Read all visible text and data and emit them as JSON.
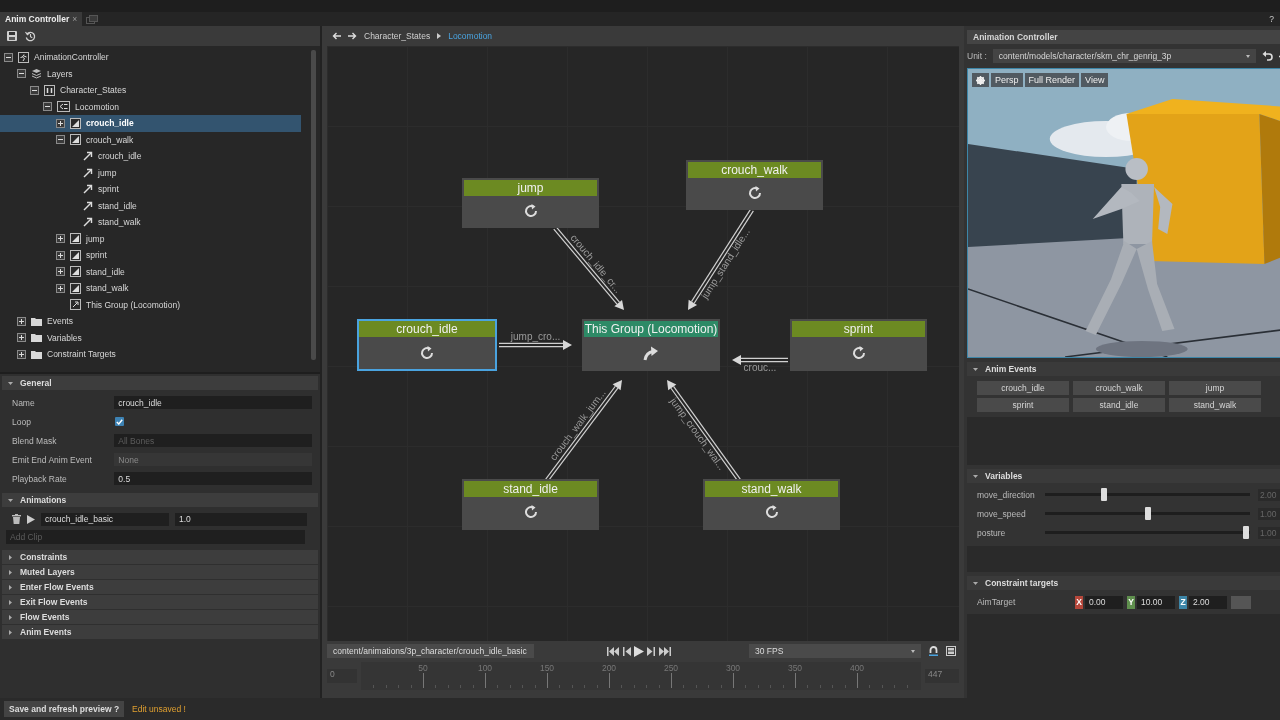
{
  "tabs": [
    {
      "label": "Anim Controller",
      "close": "×",
      "selected": true
    }
  ],
  "help": "?",
  "tree": [
    {
      "label": "AnimationController",
      "kind": "root",
      "expanded": true,
      "selected": false,
      "children": [
        {
          "label": "Layers",
          "kind": "layers",
          "expanded": true,
          "selected": false,
          "children": [
            {
              "label": "Character_States",
              "kind": "layer",
              "expanded": true,
              "selected": false,
              "children": [
                {
                  "label": "Locomotion",
                  "kind": "group",
                  "expanded": true,
                  "selected": false,
                  "children": [
                    {
                      "label": "crouch_idle",
                      "kind": "state",
                      "expanded": false,
                      "selected": true
                    },
                    {
                      "label": "crouch_walk",
                      "kind": "state",
                      "expanded": true,
                      "selected": false,
                      "children": [
                        {
                          "label": "crouch_idle",
                          "kind": "transition",
                          "selected": false
                        },
                        {
                          "label": "jump",
                          "kind": "transition",
                          "selected": false
                        },
                        {
                          "label": "sprint",
                          "kind": "transition",
                          "selected": false
                        },
                        {
                          "label": "stand_idle",
                          "kind": "transition",
                          "selected": false
                        },
                        {
                          "label": "stand_walk",
                          "kind": "transition",
                          "selected": false
                        }
                      ]
                    },
                    {
                      "label": "jump",
                      "kind": "state",
                      "expanded": false,
                      "selected": false
                    },
                    {
                      "label": "sprint",
                      "kind": "state",
                      "expanded": false,
                      "selected": false
                    },
                    {
                      "label": "stand_idle",
                      "kind": "state",
                      "expanded": false,
                      "selected": false
                    },
                    {
                      "label": "stand_walk",
                      "kind": "state",
                      "expanded": false,
                      "selected": false
                    },
                    {
                      "label": "This Group (Locomotion)",
                      "kind": "exit",
                      "selected": false
                    }
                  ]
                }
              ]
            }
          ]
        },
        {
          "label": "Events",
          "kind": "folder",
          "expanded": false,
          "selected": false
        },
        {
          "label": "Variables",
          "kind": "folder",
          "expanded": false,
          "selected": false
        },
        {
          "label": "Constraint Targets",
          "kind": "folder",
          "expanded": false,
          "selected": false
        }
      ]
    }
  ],
  "sections": [
    {
      "title": "General",
      "kind": "fields",
      "expanded": true,
      "fields": [
        {
          "label": "Name",
          "kind": "text",
          "value": "crouch_idle",
          "disabled": false
        },
        {
          "label": "Loop",
          "kind": "checkbox",
          "checked": true
        },
        {
          "label": "Blend Mask",
          "kind": "text",
          "placeholder": "All Bones",
          "disabled": false
        },
        {
          "label": "Emit End Anim Event",
          "kind": "text",
          "placeholder": "None",
          "disabled": true
        },
        {
          "label": "Playback Rate",
          "kind": "text",
          "value": "0.5",
          "disabled": false
        }
      ]
    },
    {
      "title": "Animations",
      "kind": "clips",
      "expanded": true,
      "clips": [
        {
          "name": "crouch_idle_basic",
          "weight": "1.0"
        }
      ],
      "add_placeholder": "Add Clip"
    },
    {
      "title": "Constraints",
      "kind": "empty",
      "expanded": false
    },
    {
      "title": "Muted Layers",
      "kind": "empty",
      "expanded": false
    },
    {
      "title": "Enter Flow Events",
      "kind": "empty",
      "expanded": false
    },
    {
      "title": "Exit Flow Events",
      "kind": "empty",
      "expanded": false
    },
    {
      "title": "Flow Events",
      "kind": "empty",
      "expanded": false
    },
    {
      "title": "Anim Events",
      "kind": "empty",
      "expanded": false
    }
  ],
  "save_button": "Save and refresh preview ?",
  "status": "Edit unsaved !",
  "breadcrumb": [
    {
      "label": "Character_States",
      "selected": false
    },
    {
      "label": "Locomotion",
      "selected": true
    }
  ],
  "graph": {
    "nodes": [
      {
        "label": "jump",
        "kind": "state",
        "selected": false,
        "edge_label": "crouch_idle_cr..."
      },
      {
        "label": "crouch_walk",
        "kind": "state",
        "selected": false,
        "edge_label": "jump_stand_idle..."
      },
      {
        "label": "crouch_idle",
        "kind": "state",
        "selected": true,
        "edge_label": "jump_cro..."
      },
      {
        "label": "This Group (Locomotion)",
        "kind": "group",
        "selected": false
      },
      {
        "label": "sprint",
        "kind": "state",
        "selected": false,
        "edge_label": "crouc..."
      },
      {
        "label": "stand_idle",
        "kind": "state",
        "selected": false,
        "edge_label": "crouch_walk_jum..."
      },
      {
        "label": "stand_walk",
        "kind": "state",
        "selected": false,
        "edge_label": "jump_crouch_wal..."
      }
    ]
  },
  "timeline": {
    "clip": "content/animations/3p_character/crouch_idle_basic",
    "fps": "30 FPS",
    "start": "0",
    "end": "447",
    "ticks": [
      "50",
      "100",
      "150",
      "200",
      "250",
      "300",
      "350",
      "400"
    ]
  },
  "preview": {
    "title": "Animation Controller",
    "unit_label": "Unit :",
    "unit": "content/models/character/skm_chr_genrig_3p",
    "view_buttons": [
      "Persp",
      "Full Render",
      "View"
    ]
  },
  "anim_events": {
    "title": "Anim Events",
    "expanded": true,
    "buttons": [
      "crouch_idle",
      "crouch_walk",
      "jump",
      "sprint",
      "stand_idle",
      "stand_walk"
    ]
  },
  "variables": {
    "title": "Variables",
    "expanded": true,
    "items": [
      {
        "name": "move_direction",
        "level": 0.29,
        "reading": "2.00"
      },
      {
        "name": "move_speed",
        "level": 0.5,
        "reading": "1.00"
      },
      {
        "name": "posture",
        "level": 0.98,
        "reading": "1.00"
      }
    ]
  },
  "constraint_targets": {
    "title": "Constraint targets",
    "expanded": true,
    "items": [
      {
        "name": "AimTarget",
        "axes": [
          {
            "axis": "X",
            "value": "0.00",
            "color": "#b5473b"
          },
          {
            "axis": "Y",
            "value": "10.00",
            "color": "#5f8f4e"
          },
          {
            "axis": "Z",
            "value": "2.00",
            "color": "#3d86a8"
          }
        ]
      }
    ]
  }
}
